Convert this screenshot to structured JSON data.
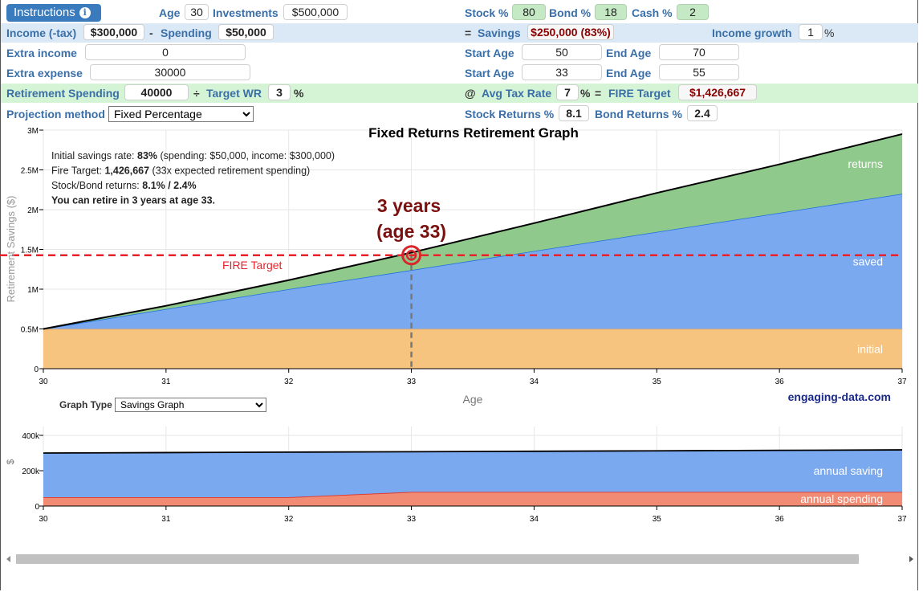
{
  "controls": {
    "instructions_label": "Instructions",
    "info_icon_glyph": "i",
    "age_label": "Age",
    "age_value": "30",
    "investments_label": "Investments",
    "investments_value": "$500,000",
    "stock_label": "Stock %",
    "stock_value": "80",
    "bond_label": "Bond %",
    "bond_value": "18",
    "cash_label": "Cash %",
    "cash_value": "2",
    "income_label": "Income (-tax)",
    "income_value": "$300,000",
    "minus_symbol": "-",
    "spending_label": "Spending",
    "spending_value": "$50,000",
    "equals_symbol": "=",
    "savings_label": "Savings",
    "savings_value": "$250,000 (83%)",
    "income_growth_label": "Income growth",
    "income_growth_value": "1",
    "percent_symbol": "%",
    "extra_income_label": "Extra income",
    "extra_income_value": "0",
    "extra_income_start_label": "Start Age",
    "extra_income_start_value": "50",
    "extra_income_end_label": "End Age",
    "extra_income_end_value": "70",
    "extra_expense_label": "Extra expense",
    "extra_expense_value": "30000",
    "extra_expense_start_label": "Start Age",
    "extra_expense_start_value": "33",
    "extra_expense_end_label": "End Age",
    "extra_expense_end_value": "55",
    "retirement_spending_label": "Retirement Spending",
    "retirement_spending_value": "40000",
    "divide_symbol": "÷",
    "target_wr_label": "Target WR",
    "target_wr_value": "3",
    "at_symbol": "@",
    "avg_tax_label": "Avg Tax Rate",
    "avg_tax_value": "7",
    "fire_target_label": "FIRE Target",
    "fire_target_value": "$1,426,667",
    "projection_label": "Projection method",
    "projection_value": "Fixed Percentage",
    "stock_returns_label": "Stock Returns %",
    "stock_returns_value": "8.1",
    "bond_returns_label": "Bond Returns %",
    "bond_returns_value": "2.4",
    "graph_type_label": "Graph Type",
    "graph_type_value": "Savings Graph"
  },
  "colors": {
    "label_blue": "#3a6fa8",
    "row_highlight_blue": "#dbe9f6",
    "row_highlight_green": "#d5f3d5",
    "initial": "#f7c47f",
    "saved": "#7aa9f0",
    "returns": "#8fc98b",
    "fire_line": "#e8222b",
    "spending": "#f28b74",
    "marker_text": "#7a1010"
  },
  "chart_data": [
    {
      "type": "area",
      "title": "Fixed Returns Retirement Graph",
      "xlabel": "Age",
      "ylabel": "Retirement Savings ($)",
      "x": [
        30,
        31,
        32,
        33,
        34,
        35,
        36,
        37
      ],
      "xlim": [
        30,
        37
      ],
      "ylim": [
        0,
        3000000
      ],
      "yticks": [
        0,
        500000,
        1000000,
        1500000,
        2000000,
        2500000,
        3000000
      ],
      "ytick_labels": [
        "0",
        "0.5M",
        "1M",
        "1.5M",
        "2M",
        "2.5M",
        "3M"
      ],
      "series": [
        {
          "name": "initial",
          "values": [
            500000,
            500000,
            500000,
            500000,
            500000,
            500000,
            500000,
            500000
          ]
        },
        {
          "name": "saved",
          "values": [
            0,
            250000,
            500000,
            740000,
            980000,
            1220000,
            1460000,
            1700000
          ]
        },
        {
          "name": "returns",
          "values": [
            0,
            41000,
            114000,
            220000,
            350000,
            490000,
            610000,
            750000
          ]
        }
      ],
      "fire_target": 1426667,
      "fire_target_label": "FIRE Target",
      "retire_marker": {
        "age": 33,
        "line1": "3 years",
        "line2": "(age 33)"
      },
      "info_lines": [
        {
          "prefix": "Initial savings rate: ",
          "bold": "83%",
          "suffix": " (spending: $50,000, income: $300,000)"
        },
        {
          "prefix": "Fire Target: ",
          "bold": "1,426,667",
          "suffix": " (33x expected retirement spending)"
        },
        {
          "prefix": "Stock/Bond returns: ",
          "bold": "8.1% / 2.4%",
          "suffix": ""
        },
        {
          "prefix": "",
          "bold": "You can retire in 3 years at age 33.",
          "suffix": ""
        }
      ],
      "watermark": "engaging-data.com",
      "grid": true
    },
    {
      "type": "area",
      "title": "",
      "xlabel": "",
      "ylabel": "$",
      "x": [
        30,
        31,
        32,
        33,
        34,
        35,
        36,
        37
      ],
      "xlim": [
        30,
        37
      ],
      "ylim": [
        0,
        450000
      ],
      "yticks": [
        0,
        200000,
        400000
      ],
      "ytick_labels": [
        "0",
        "200k",
        "400k"
      ],
      "series": [
        {
          "name": "annual spending",
          "values": [
            50000,
            50000,
            50000,
            80000,
            80000,
            80000,
            80000,
            80000
          ]
        },
        {
          "name": "annual saving",
          "values": [
            250000,
            252500,
            255000,
            227550,
            230050,
            232600,
            235200,
            237800
          ]
        }
      ],
      "grid": true
    }
  ]
}
